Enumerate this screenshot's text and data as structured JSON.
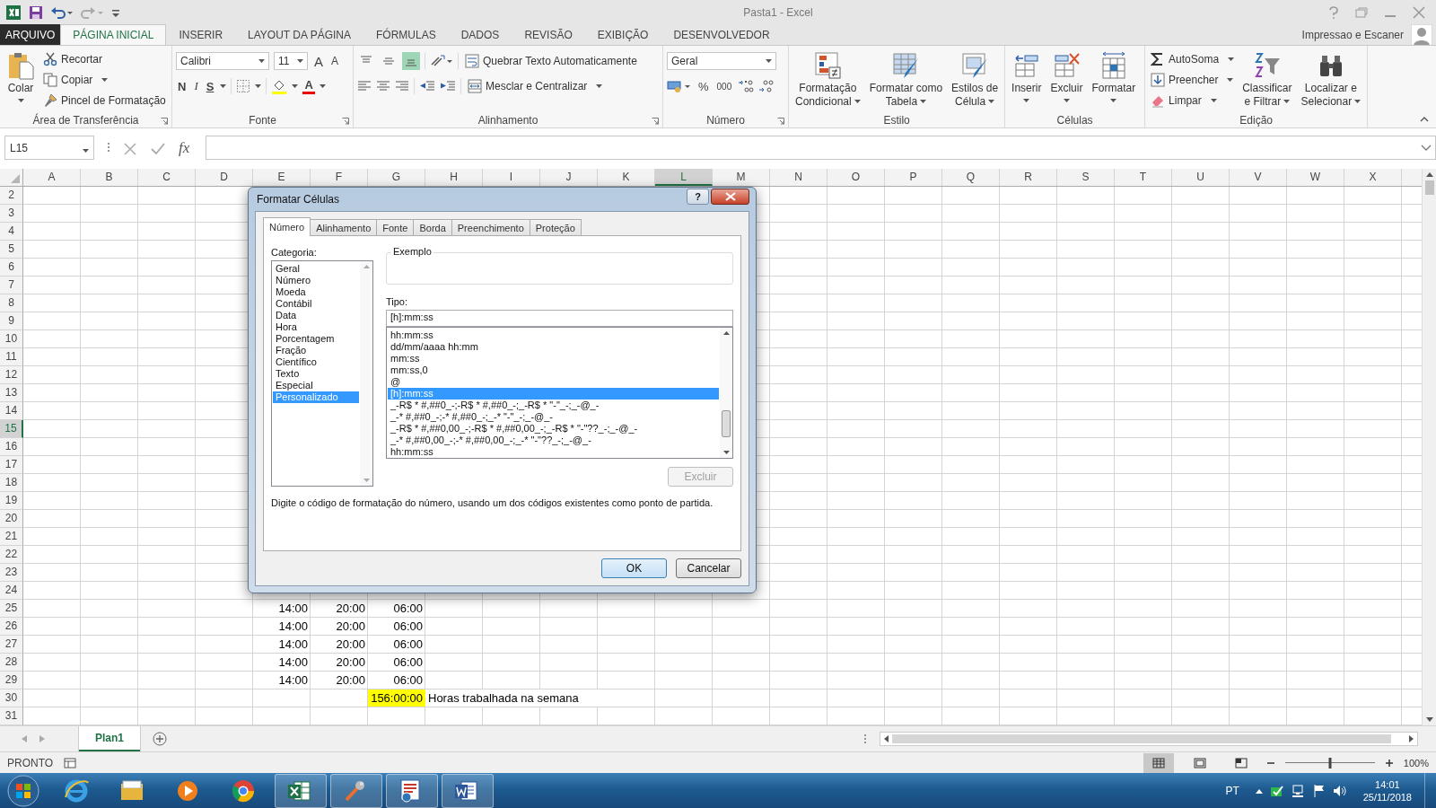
{
  "window": {
    "title": "Pasta1 - Excel",
    "account": "Impressao e Escaner"
  },
  "ribbon_tabs": [
    {
      "label": "ARQUIVO",
      "kind": "file",
      "selected": false
    },
    {
      "label": "PÁGINA INICIAL",
      "kind": "tab",
      "selected": true
    },
    {
      "label": "INSERIR",
      "kind": "tab",
      "selected": false
    },
    {
      "label": "LAYOUT DA PÁGINA",
      "kind": "tab",
      "selected": false
    },
    {
      "label": "FÓRMULAS",
      "kind": "tab",
      "selected": false
    },
    {
      "label": "DADOS",
      "kind": "tab",
      "selected": false
    },
    {
      "label": "REVISÃO",
      "kind": "tab",
      "selected": false
    },
    {
      "label": "EXIBIÇÃO",
      "kind": "tab",
      "selected": false
    },
    {
      "label": "DESENVOLVEDOR",
      "kind": "tab",
      "selected": false
    }
  ],
  "ribbon": {
    "clipboard": {
      "title": "Área de Transferência",
      "paste": "Colar",
      "cut": "Recortar",
      "copy": "Copiar",
      "painter": "Pincel de Formatação"
    },
    "font": {
      "title": "Fonte",
      "family": "Calibri",
      "size": "11",
      "grow": "A",
      "shrink": "A",
      "bold": "N",
      "italic": "I",
      "underline": "S",
      "color_label": "A"
    },
    "alignment": {
      "title": "Alinhamento",
      "valign": [
        {
          "selected": false
        },
        {
          "selected": false
        },
        {
          "selected": true
        }
      ],
      "wrap": "Quebrar Texto Automaticamente",
      "merge": "Mesclar e Centralizar"
    },
    "number": {
      "title": "Número",
      "format": "Geral",
      "percent": "%",
      "thousands": "000"
    },
    "styles": {
      "title": "Estilo",
      "conditional": [
        "Formatação",
        "Condicional"
      ],
      "table": [
        "Formatar como",
        "Tabela"
      ],
      "cell": [
        "Estilos de",
        "Célula"
      ]
    },
    "cells": {
      "title": "Células",
      "insert": "Inserir",
      "delete": "Excluir",
      "format": "Formatar"
    },
    "editing": {
      "title": "Edição",
      "autosum": "AutoSoma",
      "fill": "Preencher",
      "clear": "Limpar",
      "sort": [
        "Classificar",
        "e Filtrar"
      ],
      "find": [
        "Localizar e",
        "Selecionar"
      ]
    }
  },
  "formula_bar": {
    "name_box": "L15",
    "function_label": "fx"
  },
  "sheet": {
    "columns": [
      {
        "label": "A",
        "selected": false
      },
      {
        "label": "B",
        "selected": false
      },
      {
        "label": "C",
        "selected": false
      },
      {
        "label": "D",
        "selected": false
      },
      {
        "label": "E",
        "selected": false
      },
      {
        "label": "F",
        "selected": false
      },
      {
        "label": "G",
        "selected": false
      },
      {
        "label": "H",
        "selected": false
      },
      {
        "label": "I",
        "selected": false
      },
      {
        "label": "J",
        "selected": false
      },
      {
        "label": "K",
        "selected": false
      },
      {
        "label": "L",
        "selected": true
      },
      {
        "label": "M",
        "selected": false
      },
      {
        "label": "N",
        "selected": false
      },
      {
        "label": "O",
        "selected": false
      },
      {
        "label": "P",
        "selected": false
      },
      {
        "label": "Q",
        "selected": false
      },
      {
        "label": "R",
        "selected": false
      },
      {
        "label": "S",
        "selected": false
      },
      {
        "label": "T",
        "selected": false
      },
      {
        "label": "U",
        "selected": false
      },
      {
        "label": "V",
        "selected": false
      },
      {
        "label": "W",
        "selected": false
      },
      {
        "label": "X",
        "selected": false
      }
    ],
    "rows": [
      {
        "number": "2",
        "selected": false
      },
      {
        "number": "3",
        "selected": false
      },
      {
        "number": "4",
        "selected": false
      },
      {
        "number": "5",
        "selected": false
      },
      {
        "number": "6",
        "selected": false
      },
      {
        "number": "7",
        "selected": false
      },
      {
        "number": "8",
        "selected": false
      },
      {
        "number": "9",
        "selected": false
      },
      {
        "number": "10",
        "selected": false
      },
      {
        "number": "11",
        "selected": false
      },
      {
        "number": "12",
        "selected": false
      },
      {
        "number": "13",
        "selected": false
      },
      {
        "number": "14",
        "selected": false
      },
      {
        "number": "15",
        "selected": true
      },
      {
        "number": "16",
        "selected": false
      },
      {
        "number": "17",
        "selected": false
      },
      {
        "number": "18",
        "selected": false
      },
      {
        "number": "19",
        "selected": false
      },
      {
        "number": "20",
        "selected": false
      },
      {
        "number": "21",
        "selected": false
      },
      {
        "number": "22",
        "selected": false
      },
      {
        "number": "23",
        "selected": false
      },
      {
        "number": "24",
        "selected": false
      },
      {
        "number": "25",
        "selected": false,
        "cells": {
          "E": {
            "value": "14:00",
            "kind": "number"
          },
          "F": {
            "value": "20:00",
            "kind": "number"
          },
          "G": {
            "value": "06:00",
            "kind": "number"
          }
        }
      },
      {
        "number": "26",
        "selected": false,
        "cells": {
          "E": {
            "value": "14:00",
            "kind": "number"
          },
          "F": {
            "value": "20:00",
            "kind": "number"
          },
          "G": {
            "value": "06:00",
            "kind": "number"
          }
        }
      },
      {
        "number": "27",
        "selected": false,
        "cells": {
          "E": {
            "value": "14:00",
            "kind": "number"
          },
          "F": {
            "value": "20:00",
            "kind": "number"
          },
          "G": {
            "value": "06:00",
            "kind": "number"
          }
        }
      },
      {
        "number": "28",
        "selected": false,
        "cells": {
          "E": {
            "value": "14:00",
            "kind": "number"
          },
          "F": {
            "value": "20:00",
            "kind": "number"
          },
          "G": {
            "value": "06:00",
            "kind": "number"
          }
        }
      },
      {
        "number": "29",
        "selected": false,
        "cells": {
          "E": {
            "value": "14:00",
            "kind": "number"
          },
          "F": {
            "value": "20:00",
            "kind": "number"
          },
          "G": {
            "value": "06:00",
            "kind": "number"
          }
        }
      },
      {
        "number": "30",
        "selected": false,
        "cells": {
          "G": {
            "value": "156:00:00",
            "kind": "number",
            "color": "#ffff00"
          },
          "H": {
            "value": "Horas trabalhada na semana",
            "kind": "text"
          }
        }
      },
      {
        "number": "31",
        "selected": false
      }
    ]
  },
  "dialog": {
    "title": "Formatar Células",
    "help": "?",
    "tabs": [
      {
        "label": "Número",
        "selected": true
      },
      {
        "label": "Alinhamento",
        "selected": false
      },
      {
        "label": "Fonte",
        "selected": false
      },
      {
        "label": "Borda",
        "selected": false
      },
      {
        "label": "Preenchimento",
        "selected": false
      },
      {
        "label": "Proteção",
        "selected": false
      }
    ],
    "category_label": "Categoria:",
    "categories": [
      {
        "label": "Geral",
        "selected": false
      },
      {
        "label": "Número",
        "selected": false
      },
      {
        "label": "Moeda",
        "selected": false
      },
      {
        "label": "Contábil",
        "selected": false
      },
      {
        "label": "Data",
        "selected": false
      },
      {
        "label": "Hora",
        "selected": false
      },
      {
        "label": "Porcentagem",
        "selected": false
      },
      {
        "label": "Fração",
        "selected": false
      },
      {
        "label": "Científico",
        "selected": false
      },
      {
        "label": "Texto",
        "selected": false
      },
      {
        "label": "Especial",
        "selected": false
      },
      {
        "label": "Personalizado",
        "selected": true
      }
    ],
    "sample_label": "Exemplo",
    "type_label": "Tipo:",
    "type_value": "[h]:mm:ss",
    "formats": [
      {
        "label": "hh:mm:ss",
        "selected": false
      },
      {
        "label": "dd/mm/aaaa hh:mm",
        "selected": false
      },
      {
        "label": "mm:ss",
        "selected": false
      },
      {
        "label": "mm:ss,0",
        "selected": false
      },
      {
        "label": "@",
        "selected": false
      },
      {
        "label": "[h]:mm:ss",
        "selected": true
      },
      {
        "label": "_-R$ * #,##0_-;-R$ * #,##0_-;_-R$ * \"-\"_-;_-@_-",
        "selected": false
      },
      {
        "label": "_-* #,##0_-;-* #,##0_-;_-* \"-\"_-;_-@_-",
        "selected": false
      },
      {
        "label": "_-R$ * #,##0,00_-;-R$ * #,##0,00_-;_-R$ * \"-\"??_-;_-@_-",
        "selected": false
      },
      {
        "label": "_-* #,##0,00_-;-* #,##0,00_-;_-* \"-\"??_-;_-@_-",
        "selected": false
      },
      {
        "label": "hh:mm:ss",
        "selected": false
      }
    ],
    "delete_button": {
      "label": "Excluir",
      "disabled": true
    },
    "description": "Digite o código de formatação do número, usando um dos códigos existentes como ponto de partida.",
    "ok": "OK",
    "cancel": "Cancelar"
  },
  "sheet_tabs": [
    {
      "label": "Plan1",
      "selected": true
    }
  ],
  "status_bar": {
    "mode": "PRONTO",
    "views": [
      {
        "selected": true
      },
      {
        "selected": false
      },
      {
        "selected": false
      }
    ],
    "zoom": {
      "level": 0.5,
      "reading": "100%"
    }
  },
  "taskbar": {
    "apps": [
      {
        "running": false
      },
      {
        "running": false
      },
      {
        "running": false
      },
      {
        "running": false
      },
      {
        "running": true
      },
      {
        "running": true
      },
      {
        "running": true
      },
      {
        "running": true
      }
    ],
    "language": "PT",
    "time": "14:01",
    "date": "25/11/2018"
  }
}
